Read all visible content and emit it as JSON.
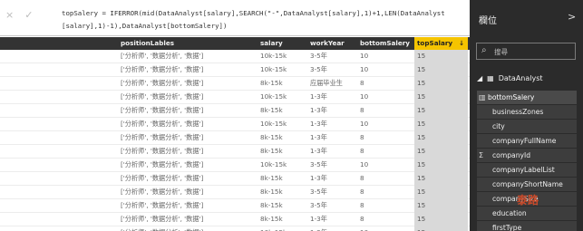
{
  "formula": {
    "line1": "topSalery = IFERROR(mid(DataAnalyst[salary],SEARCH(\"-\",DataAnalyst[salary],1)+1,LEN(DataAnalyst",
    "line2": "[salary],1)-1),DataAnalyst[bottomSalery])",
    "cancel_icon": "×",
    "commit_icon": "✓"
  },
  "table": {
    "columns": [
      "positionLables",
      "salary",
      "workYear",
      "bottomSalery",
      "topSalary"
    ],
    "selected_column_index": 4,
    "rows": [
      [
        "['分析师', '数据分析', '数据']",
        "10k-15k",
        "3-5年",
        "10",
        "15"
      ],
      [
        "['分析师', '数据分析', '数据']",
        "10k-15k",
        "3-5年",
        "10",
        "15"
      ],
      [
        "['分析师', '数据分析', '数据']",
        "8k-15k",
        "应届毕业生",
        "8",
        "15"
      ],
      [
        "['分析师', '数据分析', '数据']",
        "10k-15k",
        "1-3年",
        "10",
        "15"
      ],
      [
        "['分析师', '数据分析', '数据']",
        "8k-15k",
        "1-3年",
        "8",
        "15"
      ],
      [
        "['分析师', '数据分析', '数据']",
        "10k-15k",
        "1-3年",
        "10",
        "15"
      ],
      [
        "['分析师', '数据分析', '数据']",
        "8k-15k",
        "1-3年",
        "8",
        "15"
      ],
      [
        "['分析师', '数据分析', '数据']",
        "8k-15k",
        "1-3年",
        "8",
        "15"
      ],
      [
        "['分析师', '数据分析', '数据']",
        "10k-15k",
        "3-5年",
        "10",
        "15"
      ],
      [
        "['分析师', '数据分析', '数据']",
        "8k-15k",
        "1-3年",
        "8",
        "15"
      ],
      [
        "['分析师', '数据分析', '数据']",
        "8k-15k",
        "3-5年",
        "8",
        "15"
      ],
      [
        "['分析师', '数据分析', '数据']",
        "8k-15k",
        "3-5年",
        "8",
        "15"
      ],
      [
        "['分析师', '数据分析', '数据']",
        "8k-15k",
        "1-3年",
        "8",
        "15"
      ],
      [
        "['分析师', '数据分析', '数据']",
        "10k-15k",
        "1-3年",
        "10",
        "15"
      ]
    ]
  },
  "panel": {
    "title": "欄位",
    "collapse_icon": ">",
    "search_placeholder": "搜尋",
    "table_name": "DataAnalyst",
    "fields": [
      "bottomSalery",
      "businessZones",
      "city",
      "companyFullName",
      "companyId",
      "companyLabelList",
      "companyShortName",
      "companySize",
      "education",
      "firstType"
    ],
    "active_field": "bottomSalery"
  },
  "watermark_text": "泰路"
}
